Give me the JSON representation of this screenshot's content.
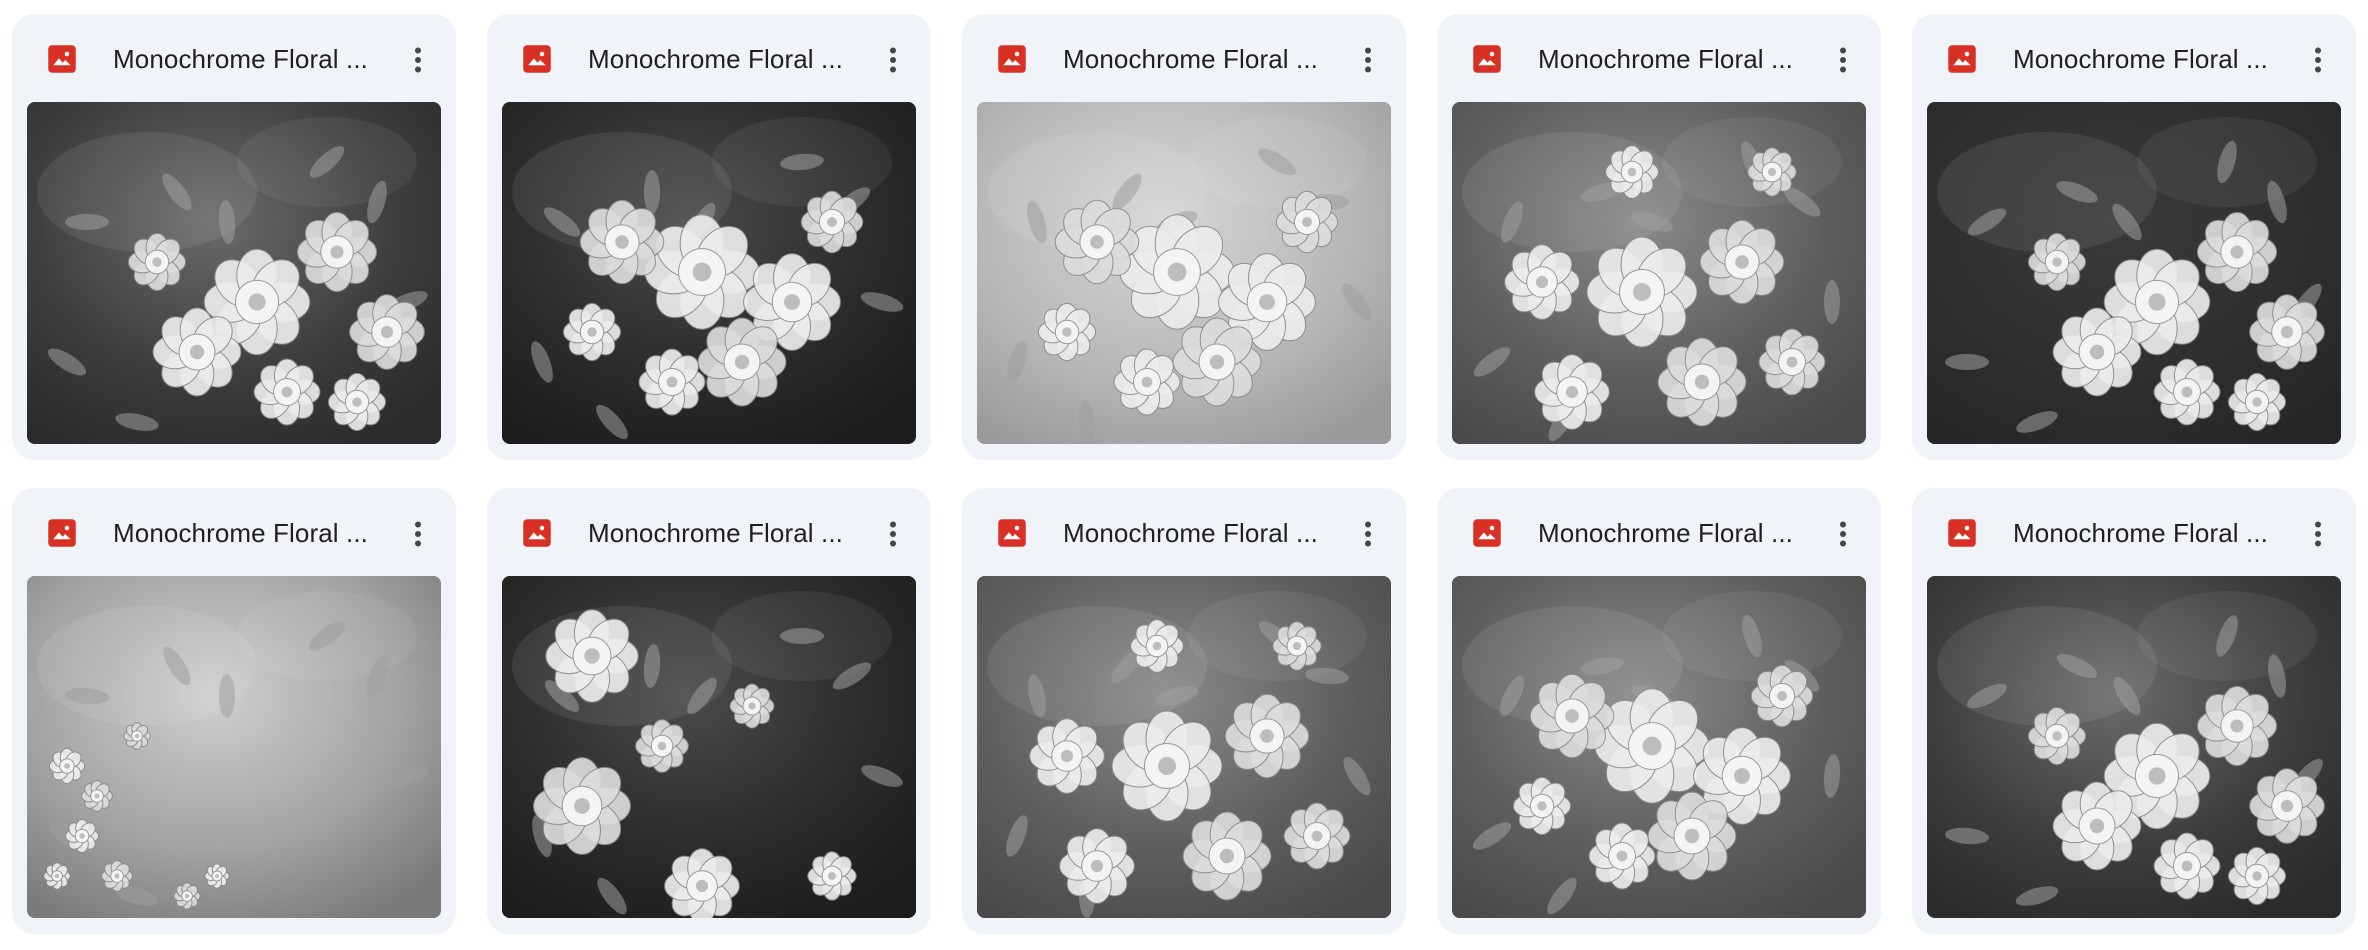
{
  "files": [
    {
      "name": "Monochrome Floral ...",
      "icon": "image-file-icon",
      "bg": "dark-smoky",
      "flowers": "cluster-right"
    },
    {
      "name": "Monochrome Floral ...",
      "icon": "image-file-icon",
      "bg": "dark",
      "flowers": "cluster-center"
    },
    {
      "name": "Monochrome Floral ...",
      "icon": "image-file-icon",
      "bg": "light",
      "flowers": "cluster-center"
    },
    {
      "name": "Monochrome Floral ...",
      "icon": "image-file-icon",
      "bg": "mid",
      "flowers": "cluster-full"
    },
    {
      "name": "Monochrome Floral ...",
      "icon": "image-file-icon",
      "bg": "dark-solid",
      "flowers": "cluster-right"
    },
    {
      "name": "Monochrome Floral ...",
      "icon": "image-file-icon",
      "bg": "light-smoky",
      "flowers": "branch-left"
    },
    {
      "name": "Monochrome Floral ...",
      "icon": "image-file-icon",
      "bg": "dark",
      "flowers": "cluster-left"
    },
    {
      "name": "Monochrome Floral ...",
      "icon": "image-file-icon",
      "bg": "mid",
      "flowers": "cluster-full"
    },
    {
      "name": "Monochrome Floral ...",
      "icon": "image-file-icon",
      "bg": "mid",
      "flowers": "cluster-center"
    },
    {
      "name": "Monochrome Floral ...",
      "icon": "image-file-icon",
      "bg": "dark-smoky",
      "flowers": "cluster-right"
    }
  ],
  "colors": {
    "card_bg": "#f0f4f9",
    "image_icon": "#d93025",
    "text": "#1f1f1f",
    "more_icon": "#444746"
  },
  "more_icon": "more-vert-icon"
}
